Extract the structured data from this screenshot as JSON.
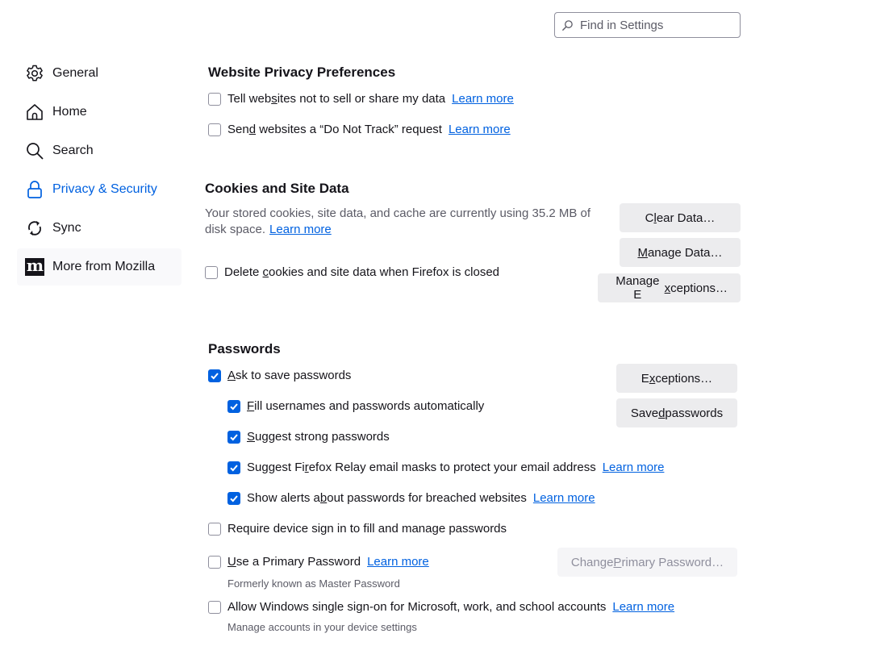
{
  "search": {
    "placeholder": "Find in Settings",
    "value": ""
  },
  "sidebar": {
    "items": [
      {
        "label": "General",
        "icon": "gear-icon",
        "active": false
      },
      {
        "label": "Home",
        "icon": "home-icon",
        "active": false
      },
      {
        "label": "Search",
        "icon": "search-icon",
        "active": false
      },
      {
        "label": "Privacy & Security",
        "icon": "lock-icon",
        "active": true
      },
      {
        "label": "Sync",
        "icon": "sync-icon",
        "active": false
      },
      {
        "label": "More from Mozilla",
        "icon": "mozilla-logo-icon",
        "active": false
      }
    ]
  },
  "colors": {
    "accent": "#0061e0",
    "text": "#15141a",
    "muted": "#5b5b66",
    "button_bg": "#ececee"
  },
  "privacy_prefs": {
    "title": "Website Privacy Preferences",
    "options": [
      {
        "pre": "Tell web",
        "ak": "s",
        "post": "ites not to sell or share my data",
        "checked": false,
        "link": "Learn more"
      },
      {
        "pre": "Sen",
        "ak": "d",
        "post": " websites a “Do Not Track” request",
        "checked": false,
        "link": "Learn more"
      }
    ]
  },
  "cookies": {
    "title": "Cookies and Site Data",
    "description": "Your stored cookies, site data, and cache are currently using 35.2 MB of disk space.",
    "link": "Learn more",
    "delete_option": {
      "pre": "Delete ",
      "ak": "c",
      "post": "ookies and site data when Firefox is closed",
      "checked": false
    },
    "buttons": {
      "clear": {
        "pre": "C",
        "ak": "l",
        "post": "ear Data…"
      },
      "manage": {
        "pre": "",
        "ak": "M",
        "post": "anage Data…"
      },
      "exceptions": {
        "pre": "Manage E",
        "ak": "x",
        "post": "ceptions…"
      }
    }
  },
  "passwords": {
    "title": "Passwords",
    "ask": {
      "pre": "",
      "ak": "A",
      "post": "sk to save passwords",
      "checked": true
    },
    "sub_options": [
      {
        "pre": "",
        "ak": "F",
        "post": "ill usernames and passwords automatically",
        "checked": true,
        "link": ""
      },
      {
        "pre": "",
        "ak": "S",
        "post": "uggest strong passwords",
        "checked": true,
        "link": ""
      },
      {
        "pre": "Suggest Fi",
        "ak": "r",
        "post": "efox Relay email masks to protect your email address",
        "checked": true,
        "link": "Learn more"
      },
      {
        "pre": "Show alerts a",
        "ak": "b",
        "post": "out passwords for breached websites",
        "checked": true,
        "link": "Learn more"
      }
    ],
    "require_device": {
      "label": "Require device sign in to fill and manage passwords",
      "checked": false
    },
    "primary": {
      "pre": "",
      "ak": "U",
      "post": "se a Primary Password",
      "checked": false,
      "link": "Learn more",
      "note": "Formerly known as Master Password"
    },
    "sso": {
      "label": "Allow Windows single sign-on for Microsoft, work, and school accounts",
      "checked": false,
      "link": "Learn more",
      "note": "Manage accounts in your device settings"
    },
    "buttons": {
      "exceptions": {
        "pre": "E",
        "ak": "x",
        "post": "ceptions…"
      },
      "saved": {
        "pre": "Save",
        "ak": "d",
        "post": " passwords"
      },
      "change_primary": {
        "pre": "Change ",
        "ak": "P",
        "post": "rimary Password…",
        "disabled": true
      }
    }
  }
}
